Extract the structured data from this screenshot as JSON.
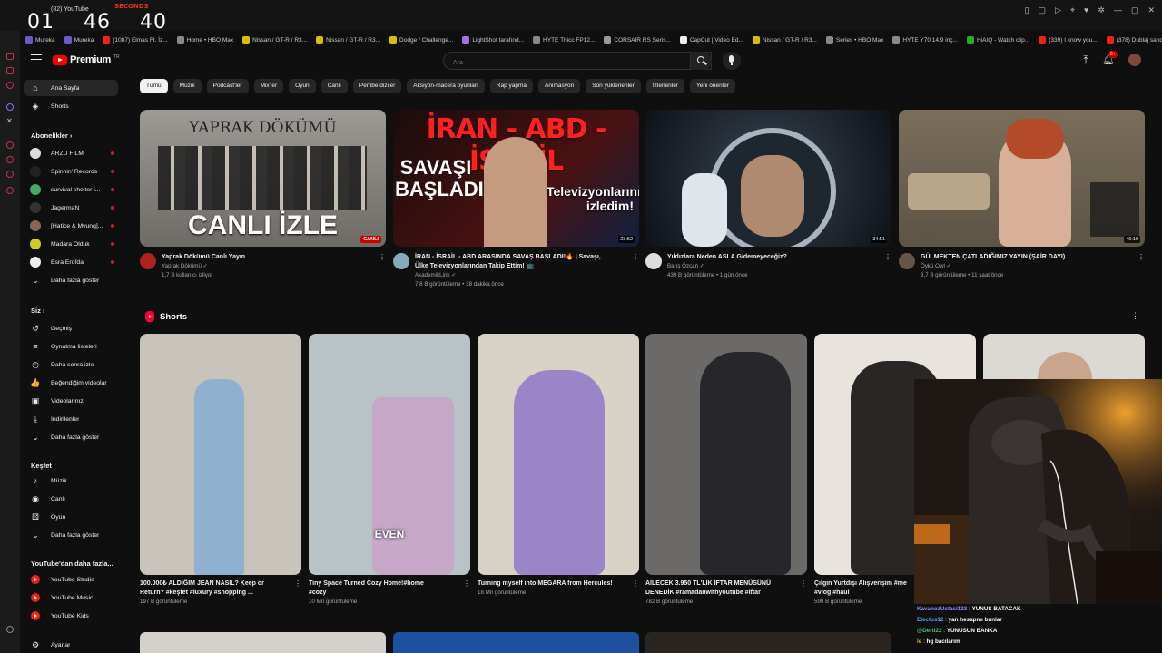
{
  "overlay": {
    "timer": {
      "hours": "01",
      "minutes": "46",
      "seconds": "40",
      "label": "SECONDS"
    },
    "tab_title": "(82) YouTube"
  },
  "bookmarks": [
    {
      "label": "Mureka",
      "color": "#6a5acd"
    },
    {
      "label": "Mureka",
      "color": "#6a5acd"
    },
    {
      "label": "(1087) Elmas Ft. İz...",
      "color": "#e21"
    },
    {
      "label": "Home • HBO Max",
      "color": "#888"
    },
    {
      "label": "Nissan / GT-R / R3...",
      "color": "#d4c000"
    },
    {
      "label": "Nissan / GT-R / R3...",
      "color": "#d4c000"
    },
    {
      "label": "Dodge / Challenge...",
      "color": "#d4c000"
    },
    {
      "label": "LightShot tarafınd...",
      "color": "#a06ee0"
    },
    {
      "label": "HYTE Thicc FP12...",
      "color": "#888"
    },
    {
      "label": "CORSAIR RS Seris...",
      "color": "#999"
    },
    {
      "label": "CapCut | Video Ed...",
      "color": "#eee"
    },
    {
      "label": "Nissan / GT-R / R3...",
      "color": "#d4c000"
    },
    {
      "label": "Series • HBO Max",
      "color": "#888"
    },
    {
      "label": "HYTE Y70 14.9 inç...",
      "color": "#888"
    },
    {
      "label": "HiAIQ - Watch clip...",
      "color": "#2a2"
    },
    {
      "label": "(339) I know you...",
      "color": "#e21"
    },
    {
      "label": "(378) Dublaj sandı...",
      "color": "#e21"
    }
  ],
  "header": {
    "logo_text": "Premium",
    "logo_sup": "TR",
    "search_placeholder": "Ara",
    "notif_count": "9+"
  },
  "nav": {
    "main": [
      {
        "label": "Ana Sayfa",
        "icon": "home-icon",
        "glyph": "⌂"
      },
      {
        "label": "Shorts",
        "icon": "shorts-icon",
        "glyph": "◈"
      }
    ],
    "subs_header": "Abonelikler  ›",
    "subs": [
      {
        "label": "ARZU FİLM",
        "color": "#ddd"
      },
      {
        "label": "Spinnin' Records",
        "color": "#222"
      },
      {
        "label": "survival shelter i...",
        "color": "#4a6"
      },
      {
        "label": "JagermaN",
        "color": "#333"
      },
      {
        "label": "[Hatice & Myung]...",
        "color": "#865"
      },
      {
        "label": "Madara Olduk",
        "color": "#cc2"
      },
      {
        "label": "Esra Eroľda",
        "color": "#eee"
      }
    ],
    "subs_more": "Daha fazla göster",
    "you_header": "Siz  ›",
    "you": [
      {
        "label": "Geçmiş",
        "glyph": "↺",
        "icon": "history-icon"
      },
      {
        "label": "Oynatma listeleri",
        "glyph": "≡",
        "icon": "playlist-icon"
      },
      {
        "label": "Daha sonra izle",
        "glyph": "◷",
        "icon": "clock-icon"
      },
      {
        "label": "Beğendiğim videolar",
        "glyph": "👍",
        "icon": "like-icon"
      },
      {
        "label": "Videolarınız",
        "glyph": "▣",
        "icon": "your-videos-icon"
      },
      {
        "label": "İndirilenler",
        "glyph": "⤓",
        "icon": "download-icon"
      },
      {
        "label": "Daha fazla göster",
        "glyph": "⌄",
        "icon": "chevron-down-icon"
      }
    ],
    "explore_header": "Keşfet",
    "explore": [
      {
        "label": "Müzik",
        "glyph": "♪",
        "icon": "music-icon"
      },
      {
        "label": "Canlı",
        "glyph": "◉",
        "icon": "live-icon"
      },
      {
        "label": "Oyun",
        "glyph": "⚄",
        "icon": "gaming-icon"
      },
      {
        "label": "Daha fazla göster",
        "glyph": "⌄",
        "icon": "chevron-down-icon"
      }
    ],
    "more_header": "YouTube'dan daha fazla...",
    "more": [
      {
        "label": "YouTube Studio"
      },
      {
        "label": "YouTube Music"
      },
      {
        "label": "YouTube Kids"
      }
    ],
    "settings": "Ayarlar"
  },
  "chips": [
    "Tümü",
    "Müzik",
    "Podcast'ler",
    "Mix'ler",
    "Oyun",
    "Canlı",
    "Pembe diziler",
    "Aksiyon-macera oyunları",
    "Rap yapma",
    "Animasyon",
    "Son yüklenenler",
    "İzlenenler",
    "Yeni öneriler"
  ],
  "videos": [
    {
      "title": "Yaprak Dökümü Canlı Yayın",
      "title2": "",
      "channel": "Yaprak Dökümü ✓",
      "stats": "1,7 B kullanıcı izliyor",
      "badge": "CANLI",
      "thumb_top": "YAPRAK DÖKÜMÜ",
      "thumb_bottom": "CANLI İZLE",
      "bg": "#8e8a84"
    },
    {
      "title": "İRAN - İSRAİL - ABD ARASINDA SAVAŞ BAŞLADI!🔥 | Savaşı,",
      "title2": "Ülke Televizyonlarından Takip Ettim! 📺",
      "channel": "AkademikLink ✓",
      "stats": "7,8 B görüntüleme • 38 dakika önce",
      "badge": "23:52",
      "thumb_top": "İRAN - ABD - İSRAİL",
      "thumb_bottom": "SAVAŞI BAŞLADI!",
      "thumb_side": "Televizyonlarını izledim!",
      "bg": "#3a1a1a"
    },
    {
      "title": "Yıldızlara Neden ASLA Gidemeyeceğiz?",
      "title2": "",
      "channel": "Barış Özcan ✓",
      "stats": "439 B görüntüleme • 1 gün önce",
      "badge": "34:51",
      "bg": "#1b2430"
    },
    {
      "title": "GÜLMEKTEN ÇATLADIĞIMIZ YAYIN (ŞAİR DAYI)",
      "title2": "",
      "channel": "Öykü Owl ✓",
      "stats": "3,7 B görüntüleme • 11 saat önce",
      "badge": "46:10",
      "bg": "#6d6250"
    }
  ],
  "shorts": {
    "title": "Shorts",
    "items": [
      {
        "title": "100.000₺ ALDIĞIM JEAN NASIL? Keep or",
        "title2": "Return? #keşfet #luxury #shopping ...",
        "views": "197 B görüntüleme",
        "bg": "#c8c3bb",
        "caption": ""
      },
      {
        "title": "Tiny Space Turned Cozy Home!#home",
        "title2": "#cozy",
        "views": "10 Mn görüntüleme",
        "bg": "#b9c3c7",
        "caption": "EVEN"
      },
      {
        "title": "Turning myself into MEGARA from Hercules!",
        "title2": "",
        "views": "18 Mn görüntüleme",
        "bg": "#d9d2c6",
        "caption": ""
      },
      {
        "title": "AİLECEK 3.950 TL'LİK İFTAR MENÜSÜNÜ",
        "title2": "DENEDİK #ramadanwithyoutube #iftar",
        "views": "782 B görüntüleme",
        "bg": "#6c6a68",
        "caption": ""
      },
      {
        "title": "Çılgın Yurtdışı Alışverişim #me",
        "title2": "#vlog #haul",
        "views": "590 B görüntüleme",
        "bg": "#e8e3dc",
        "caption": ""
      },
      {
        "title": "",
        "title2": "",
        "views": "",
        "bg": "#dcd8d4",
        "caption": ""
      }
    ]
  },
  "chat": [
    {
      "user": "KavanozUstasi123",
      "msg": "YUNUS BATACAK",
      "color": "#9b8cff"
    },
    {
      "user": "Electus12",
      "msg": "yan hesapmı bunlar",
      "color": "#4aa3ff"
    },
    {
      "user": "@Derti22",
      "msg": "YUNUSUN BANKA",
      "color": "#57c26b"
    },
    {
      "user": "le",
      "msg": "hg bacılarım",
      "color": "#e0a030"
    }
  ]
}
